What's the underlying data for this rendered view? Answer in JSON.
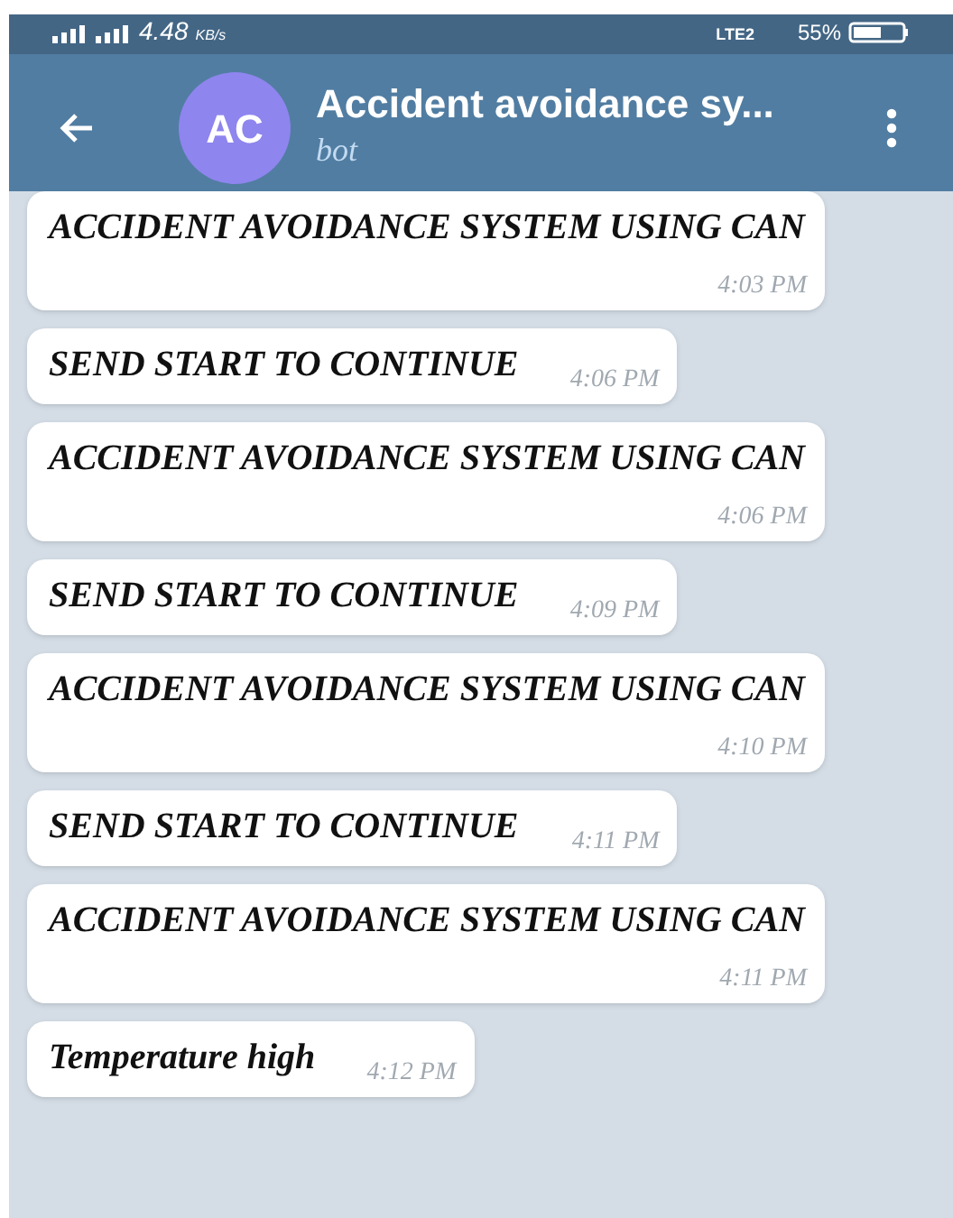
{
  "status_bar": {
    "speed": "4.48",
    "speed_unit": "KB/s",
    "network": "LTE2",
    "battery": "55%"
  },
  "header": {
    "avatar": "AC",
    "title": "Accident avoidance sy...",
    "subtitle": "bot"
  },
  "messages": [
    {
      "text": "ACCIDENT AVOIDANCE SYSTEM USING CAN",
      "time": "4:03 PM"
    },
    {
      "text": "SEND START TO CONTINUE",
      "time": "4:06 PM"
    },
    {
      "text": "ACCIDENT AVOIDANCE SYSTEM USING CAN",
      "time": "4:06 PM"
    },
    {
      "text": "SEND START TO CONTINUE",
      "time": "4:09 PM"
    },
    {
      "text": "ACCIDENT AVOIDANCE SYSTEM USING CAN",
      "time": "4:10 PM"
    },
    {
      "text": "SEND START TO CONTINUE",
      "time": "4:11 PM"
    },
    {
      "text": "ACCIDENT AVOIDANCE SYSTEM USING CAN",
      "time": "4:11 PM"
    },
    {
      "text": "Temperature high",
      "time": "4:12 PM"
    }
  ]
}
